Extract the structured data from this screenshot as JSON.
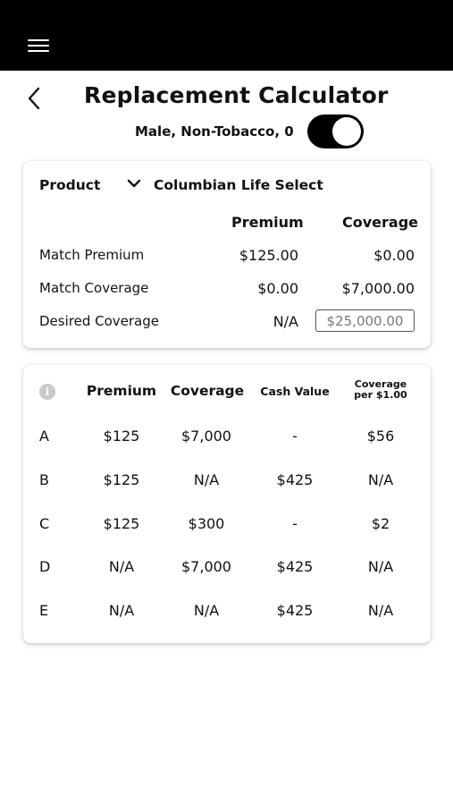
{
  "header": {
    "menu_icon": "hamburger-menu-icon",
    "back_icon": "chevron-left-icon",
    "title": "Replacement Calculator"
  },
  "profile": {
    "label": "Male, Non-Tobacco, 0",
    "toggle_on": true
  },
  "inputs_card": {
    "product_label": "Product",
    "product_value": "Columbian Life  Select",
    "columns": [
      "Premium",
      "Coverage"
    ],
    "rows": [
      {
        "label": "Match Premium",
        "premium": "$125.00",
        "coverage": "$0.00"
      },
      {
        "label": "Match Coverage",
        "premium": "$0.00",
        "coverage": "$7,000.00"
      },
      {
        "label": "Desired Coverage",
        "premium": "N/A",
        "coverage": "$25,000.00"
      }
    ]
  },
  "results_table": {
    "info_icon": "info-icon",
    "columns": [
      "Premium",
      "Coverage",
      "Cash Value",
      "Coverage per $1.00"
    ],
    "column_lines": [
      "Coverage",
      "per $1.00"
    ],
    "rows": [
      {
        "label": "A",
        "cells": [
          "$125",
          "$7,000",
          "-",
          "$56"
        ]
      },
      {
        "label": "B",
        "cells": [
          "$125",
          "N/A",
          "$425",
          "N/A"
        ]
      },
      {
        "label": "C",
        "cells": [
          "$125",
          "$300",
          "-",
          "$2"
        ]
      },
      {
        "label": "D",
        "cells": [
          "N/A",
          "$7,000",
          "$425",
          "N/A"
        ]
      },
      {
        "label": "E",
        "cells": [
          "N/A",
          "N/A",
          "$425",
          "N/A"
        ]
      }
    ]
  },
  "colors": {
    "topbar": "#000000",
    "toggle": "#000000",
    "card_background": "#ffffff"
  }
}
